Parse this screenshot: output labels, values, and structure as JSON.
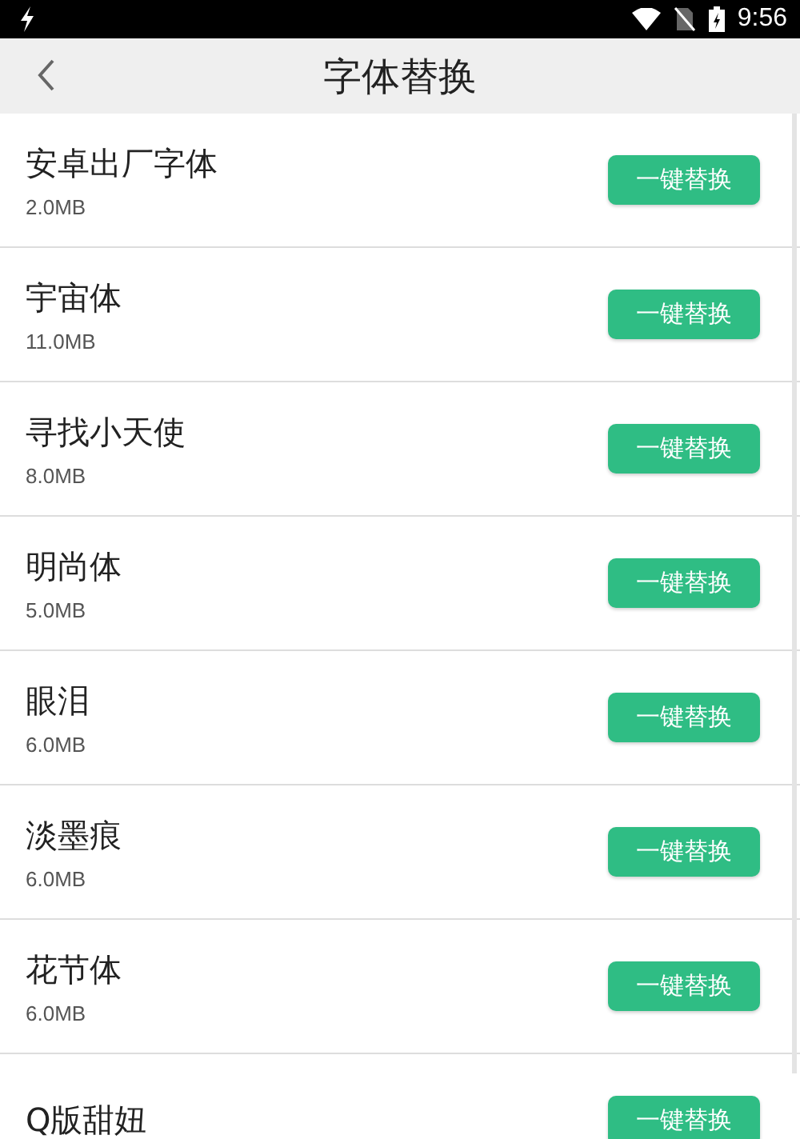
{
  "status_bar": {
    "time": "9:56"
  },
  "header": {
    "title": "字体替换"
  },
  "fonts": [
    {
      "name": "安卓出厂字体",
      "size": "2.0MB",
      "button": "一键替换"
    },
    {
      "name": "宇宙体",
      "size": "11.0MB",
      "button": "一键替换"
    },
    {
      "name": "寻找小天使",
      "size": "8.0MB",
      "button": "一键替换"
    },
    {
      "name": "明尚体",
      "size": "5.0MB",
      "button": "一键替换"
    },
    {
      "name": "眼泪",
      "size": "6.0MB",
      "button": "一键替换"
    },
    {
      "name": "淡墨痕",
      "size": "6.0MB",
      "button": "一键替换"
    },
    {
      "name": "花节体",
      "size": "6.0MB",
      "button": "一键替换"
    },
    {
      "name": "Q版甜妞",
      "button": "一键替换"
    }
  ]
}
